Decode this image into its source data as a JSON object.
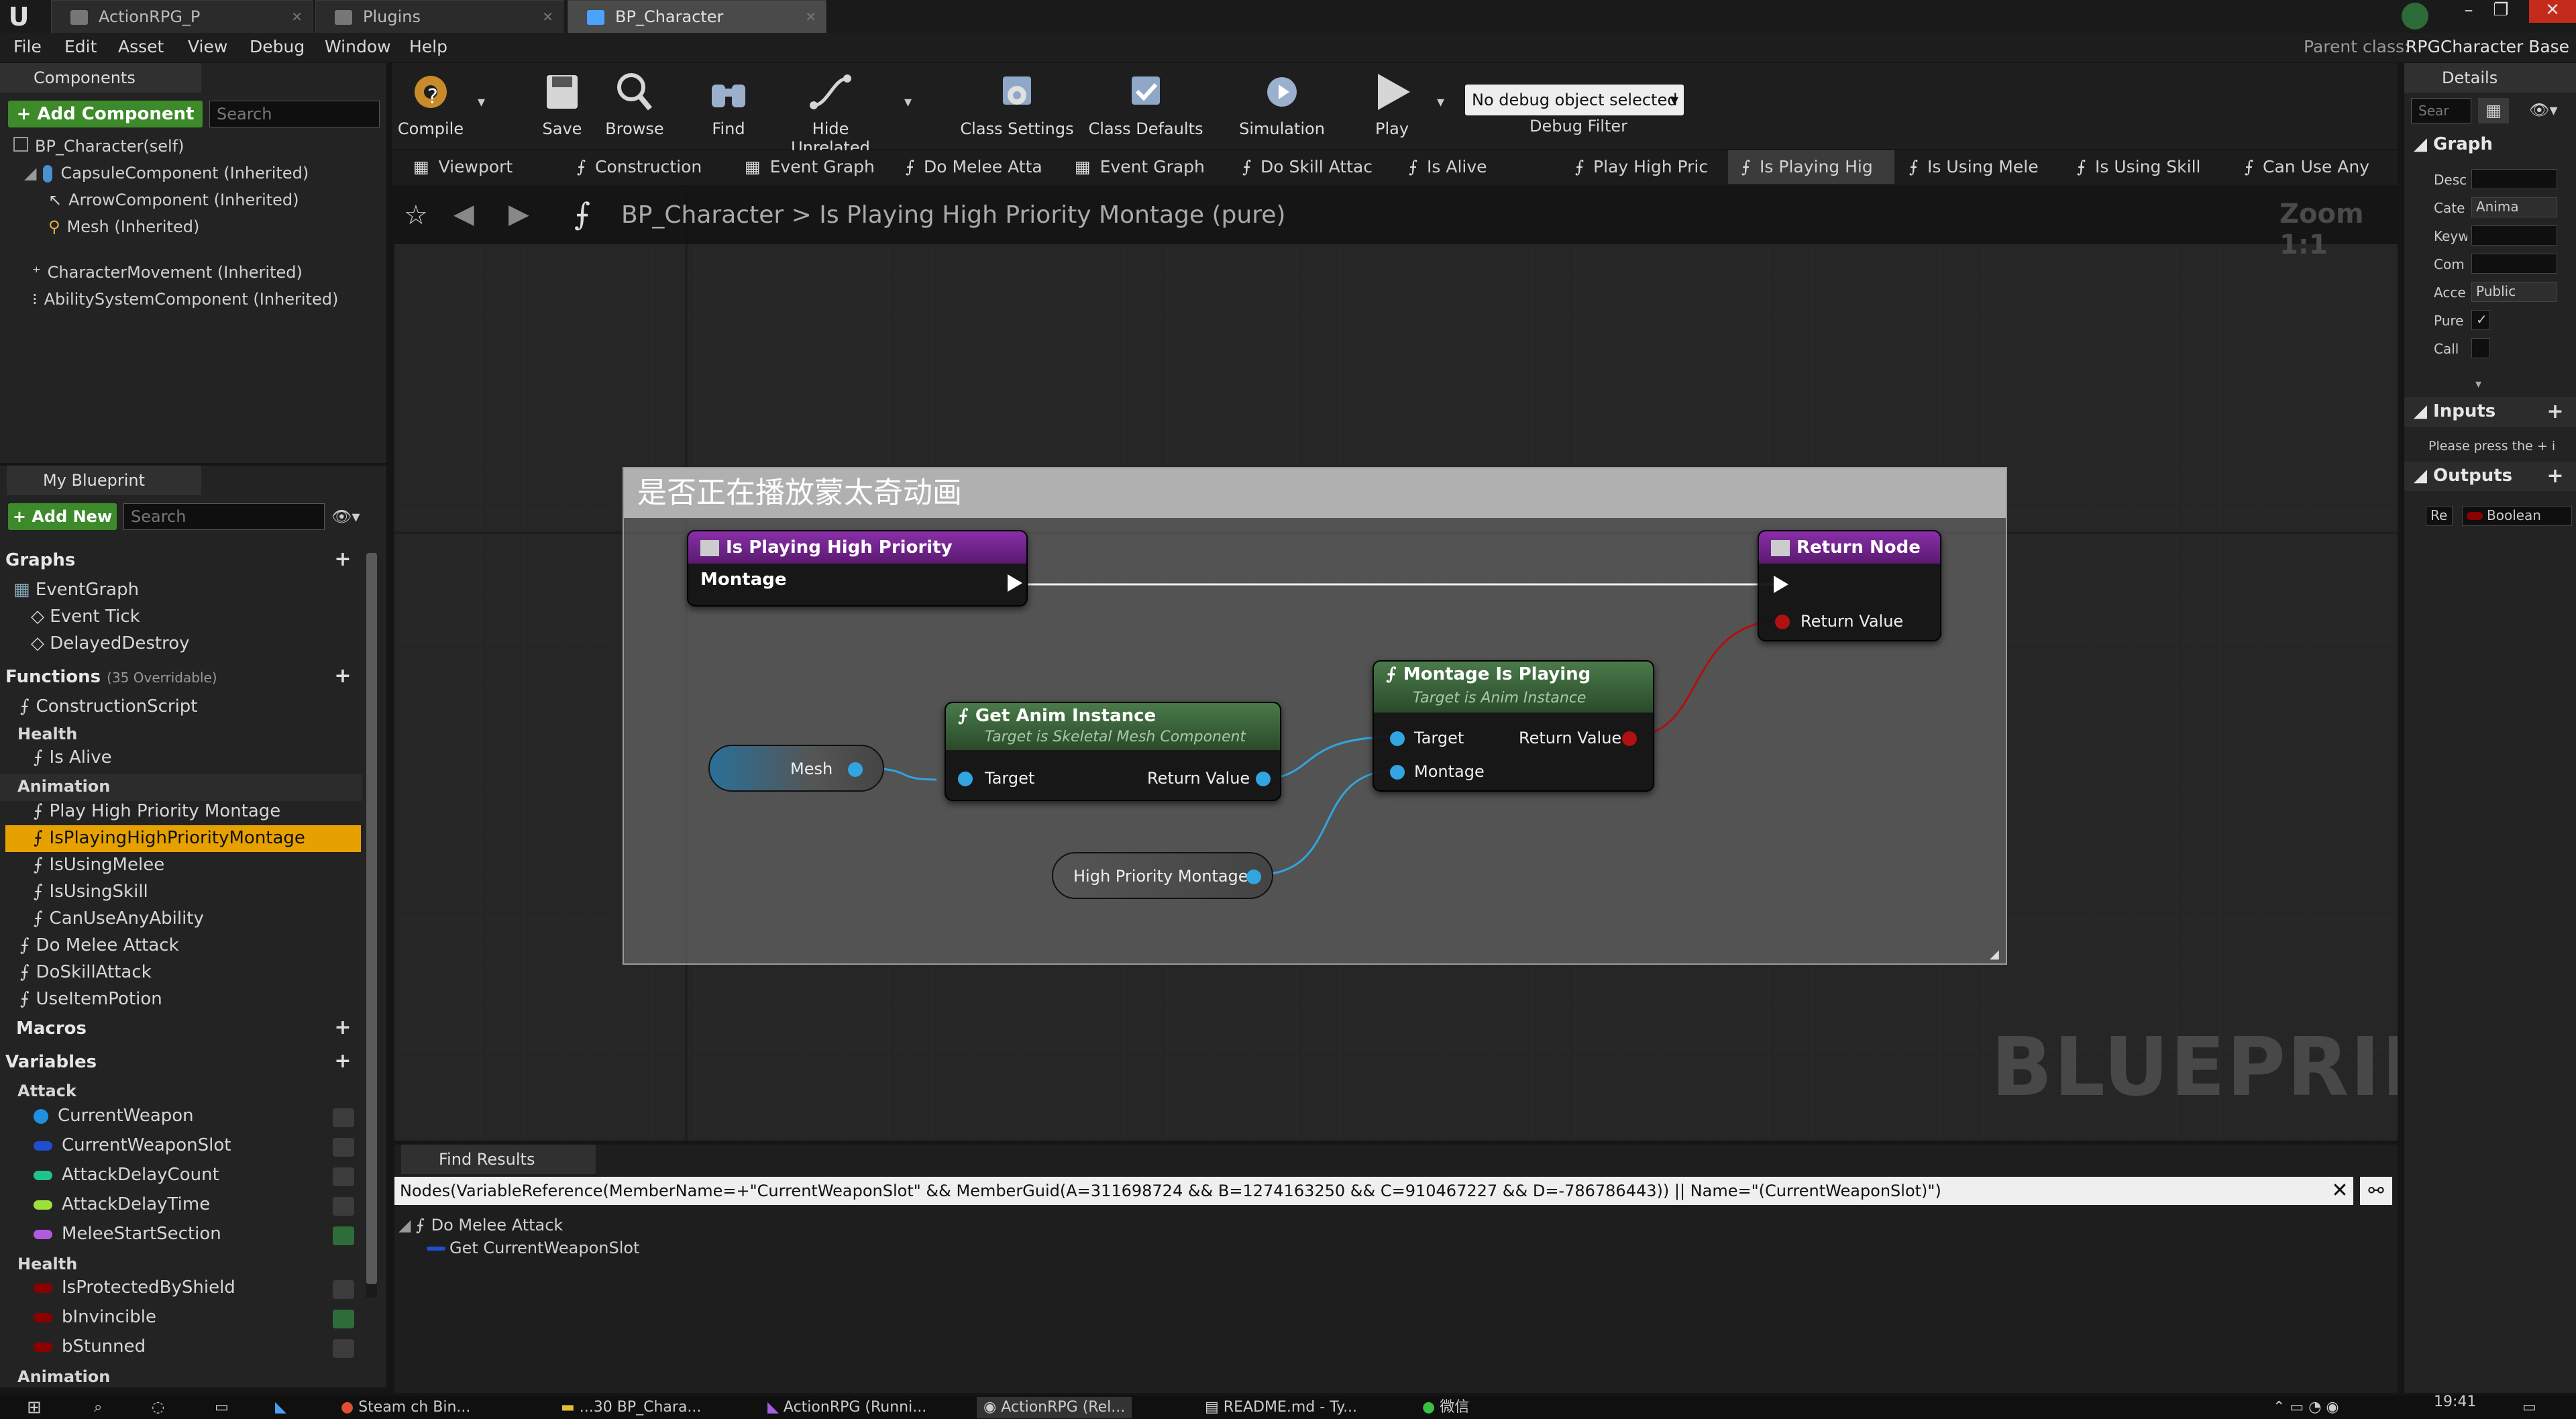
{
  "titlebar": {
    "tabs": [
      {
        "label": "ActionRPG_P"
      },
      {
        "label": "Plugins"
      },
      {
        "label": "BP_Character"
      }
    ]
  },
  "menubar": {
    "items": [
      "File",
      "Edit",
      "Asset",
      "View",
      "Debug",
      "Window",
      "Help"
    ],
    "parent_class_label": "Parent class:",
    "parent_class_value": "RPGCharacter Base"
  },
  "components": {
    "title": "Components",
    "add_button": "+ Add Component",
    "search_placeholder": "Search",
    "items": [
      "BP_Character(self)",
      "CapsuleComponent (Inherited)",
      "ArrowComponent (Inherited)",
      "Mesh (Inherited)",
      "CharacterMovement (Inherited)",
      "AbilitySystemComponent (Inherited)"
    ]
  },
  "my_blueprint": {
    "title": "My Blueprint",
    "add_button": "+ Add New",
    "search_placeholder": "Search",
    "graphs_header": "Graphs",
    "graphs": [
      "EventGraph",
      "Event Tick",
      "DelayedDestroy"
    ],
    "functions_header": "Functions",
    "functions_overridable": "(35 Overridable)",
    "functions_top": [
      "ConstructionScript"
    ],
    "health_header": "Health",
    "health_functions": [
      "Is Alive"
    ],
    "animation_header": "Animation",
    "animation_functions": [
      "Play High Priority Montage",
      "IsPlayingHighPriorityMontage",
      "IsUsingMelee",
      "IsUsingSkill",
      "CanUseAnyAbility"
    ],
    "other_functions": [
      "Do Melee Attack",
      "DoSkillAttack",
      "UseItemPotion"
    ],
    "macros_header": "Macros",
    "variables_header": "Variables",
    "attack_header": "Attack",
    "attack_vars": [
      {
        "name": "CurrentWeapon",
        "color": "#1f8fe0"
      },
      {
        "name": "CurrentWeaponSlot",
        "color": "#1f4fd0"
      },
      {
        "name": "AttackDelayCount",
        "color": "#1fc48a"
      },
      {
        "name": "AttackDelayTime",
        "color": "#9ee03a"
      },
      {
        "name": "MeleeStartSection",
        "color": "#b05ae0"
      }
    ],
    "health_vars_header": "Health",
    "health_vars": [
      {
        "name": "IsProtectedByShield",
        "color": "#8b0000"
      },
      {
        "name": "bInvincible",
        "color": "#8b0000"
      },
      {
        "name": "bStunned",
        "color": "#8b0000"
      }
    ],
    "animation_vars_header": "Animation"
  },
  "toolbar": {
    "compile": "Compile",
    "save": "Save",
    "browse": "Browse",
    "find": "Find",
    "hide_unrelated": "Hide Unrelated",
    "class_settings": "Class Settings",
    "class_defaults": "Class Defaults",
    "simulation": "Simulation",
    "play": "Play",
    "debug_select": "No debug object selected",
    "debug_filter": "Debug Filter"
  },
  "graph_tabs": [
    "Viewport",
    "Construction",
    "Event Graph",
    "Do Melee Atta",
    "Event Graph",
    "Do Skill Attac",
    "Is Alive",
    "Play High Pric",
    "Is Playing Hig",
    "Is Using Mele",
    "Is Using Skill",
    "Can Use Any"
  ],
  "breadcrumb": {
    "root": "BP_Character",
    "separator": ">",
    "current": "Is Playing High Priority Montage (pure)",
    "zoom": "Zoom 1:1"
  },
  "graph": {
    "comment": "是否正在播放蒙太奇动画",
    "watermark": "BLUEPRINT",
    "entry_node": "Is Playing High Priority Montage",
    "return_node": "Return Node",
    "return_value": "Return Value",
    "mesh_var": "Mesh",
    "get_anim_title": "Get Anim Instance",
    "get_anim_sub": "Target is Skeletal Mesh Component",
    "target": "Target",
    "return_value_pin": "Return Value",
    "montage_title": "Montage Is Playing",
    "montage_sub": "Target is Anim Instance",
    "montage_target": "Target",
    "montage_return": "Return Value",
    "montage_pin": "Montage",
    "hpm_var": "High Priority Montage"
  },
  "find_results": {
    "title": "Find Results",
    "query": "Nodes(VariableReference(MemberName=+\"CurrentWeaponSlot\" && MemberGuid(A=311698724 && B=1274163250 && C=910467227 && D=-786786443)) || Name=\"(CurrentWeaponSlot)\")",
    "result_root": "Do Melee Attack",
    "result_child": "Get CurrentWeaponSlot"
  },
  "details": {
    "title": "Details",
    "search_placeholder": "Sear",
    "graph_header": "Graph",
    "rows": [
      {
        "label": "Desc",
        "value": ""
      },
      {
        "label": "Cate",
        "value": "Anima"
      },
      {
        "label": "Keyw",
        "value": ""
      },
      {
        "label": "Com",
        "value": ""
      },
      {
        "label": "Acce",
        "value": "Public"
      },
      {
        "label": "Pure",
        "value": "✓"
      },
      {
        "label": "Call",
        "value": ""
      }
    ],
    "inputs_header": "Inputs",
    "inputs_hint": "Please press the + i",
    "outputs_header": "Outputs",
    "output_name": "Re",
    "output_type": "Boolean"
  },
  "taskbar": {
    "time": "19:41",
    "items": [
      "Steam ch Bin...",
      "...30 BP_Chara...",
      "ActionRPG (Runni...",
      "ActionRPG (Rel...",
      "README.md - Ty...",
      "微信"
    ]
  }
}
